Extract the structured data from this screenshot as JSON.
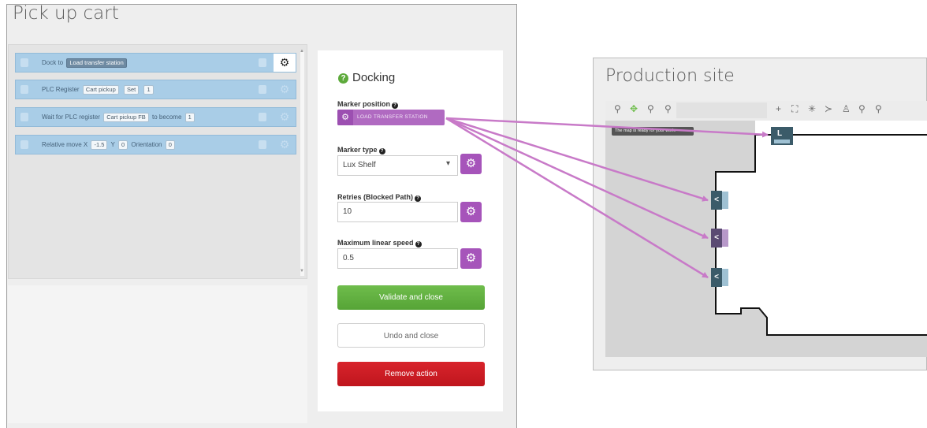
{
  "editor": {
    "title": "Pick up cart",
    "actions": [
      {
        "label": "Dock to",
        "chip1": "Load transfer station"
      },
      {
        "label": "PLC Register",
        "chip1": "Cart pickup",
        "chip2": "Set",
        "chip3": "1"
      },
      {
        "label": "Wait for PLC register",
        "chip1": "Cart pickup FB",
        "label2": "to become",
        "chip2": "1"
      },
      {
        "label": "Relative move X",
        "chip1": "-1.5",
        "label2": "Y",
        "chip2": "0",
        "label3": "Orientation",
        "chip3": "0"
      }
    ]
  },
  "docking": {
    "title": "Docking",
    "marker_position": {
      "label": "Marker position",
      "value": "LOAD TRANSFER STATION"
    },
    "marker_type": {
      "label": "Marker type",
      "value": "Lux Shelf"
    },
    "retries": {
      "label": "Retries (Blocked Path)",
      "value": "10"
    },
    "max_speed": {
      "label": "Maximum linear speed",
      "value": "0.5"
    },
    "buttons": {
      "validate": "Validate and close",
      "undo": "Undo and close",
      "remove": "Remove action"
    }
  },
  "map": {
    "title": "Production site",
    "message": "The map is ready for your work."
  },
  "colors": {
    "accent_purple": "#a654ba",
    "validate_green": "#5aae39",
    "remove_red": "#cf1c24",
    "arrow_pink": "#c87ac8",
    "action_blue": "#a9cde7"
  }
}
